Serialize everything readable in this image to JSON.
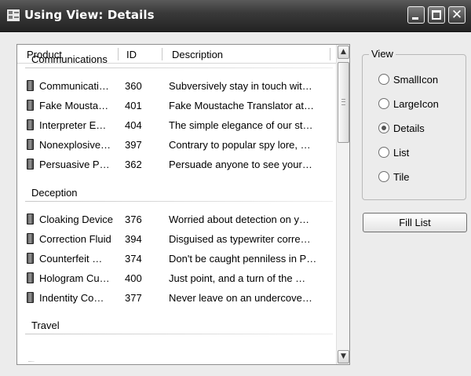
{
  "window": {
    "title": "Using View: Details",
    "close_glyph": "✕"
  },
  "listview": {
    "columns": [
      "Product",
      "ID",
      "Description"
    ],
    "groups": [
      {
        "name": "Communications",
        "rows": [
          {
            "product": "Communicati…",
            "id": "360",
            "description": "Subversively stay in touch wit…"
          },
          {
            "product": "Fake Mousta…",
            "id": "401",
            "description": "Fake Moustache Translator at…"
          },
          {
            "product": "Interpreter E…",
            "id": "404",
            "description": "The simple elegance of our st…"
          },
          {
            "product": "Nonexplosive…",
            "id": "397",
            "description": "Contrary to popular spy lore, …"
          },
          {
            "product": "Persuasive P…",
            "id": "362",
            "description": "Persuade anyone to see your…"
          }
        ]
      },
      {
        "name": "Deception",
        "rows": [
          {
            "product": "Cloaking Device",
            "id": "376",
            "description": "Worried about detection on y…"
          },
          {
            "product": "Correction Fluid",
            "id": "394",
            "description": "Disguised as typewriter corre…"
          },
          {
            "product": "Counterfeit …",
            "id": "374",
            "description": "Don't be caught penniless in P…"
          },
          {
            "product": "Hologram Cu…",
            "id": "400",
            "description": "Just point, and a turn of the …"
          },
          {
            "product": "Indentity Co…",
            "id": "377",
            "description": "Never leave on an undercove…"
          }
        ]
      },
      {
        "name": "Travel",
        "rows": []
      }
    ],
    "scroll_up_glyph": "▲",
    "scroll_down_glyph": "▼"
  },
  "view_group": {
    "title": "View",
    "options": [
      {
        "label": "SmallIcon",
        "checked": false
      },
      {
        "label": "LargeIcon",
        "checked": false
      },
      {
        "label": "Details",
        "checked": true
      },
      {
        "label": "List",
        "checked": false
      },
      {
        "label": "Tile",
        "checked": false
      }
    ]
  },
  "fill_button": {
    "label": "Fill List"
  },
  "icons": {
    "app": "form-icon",
    "item": "device-icon"
  }
}
